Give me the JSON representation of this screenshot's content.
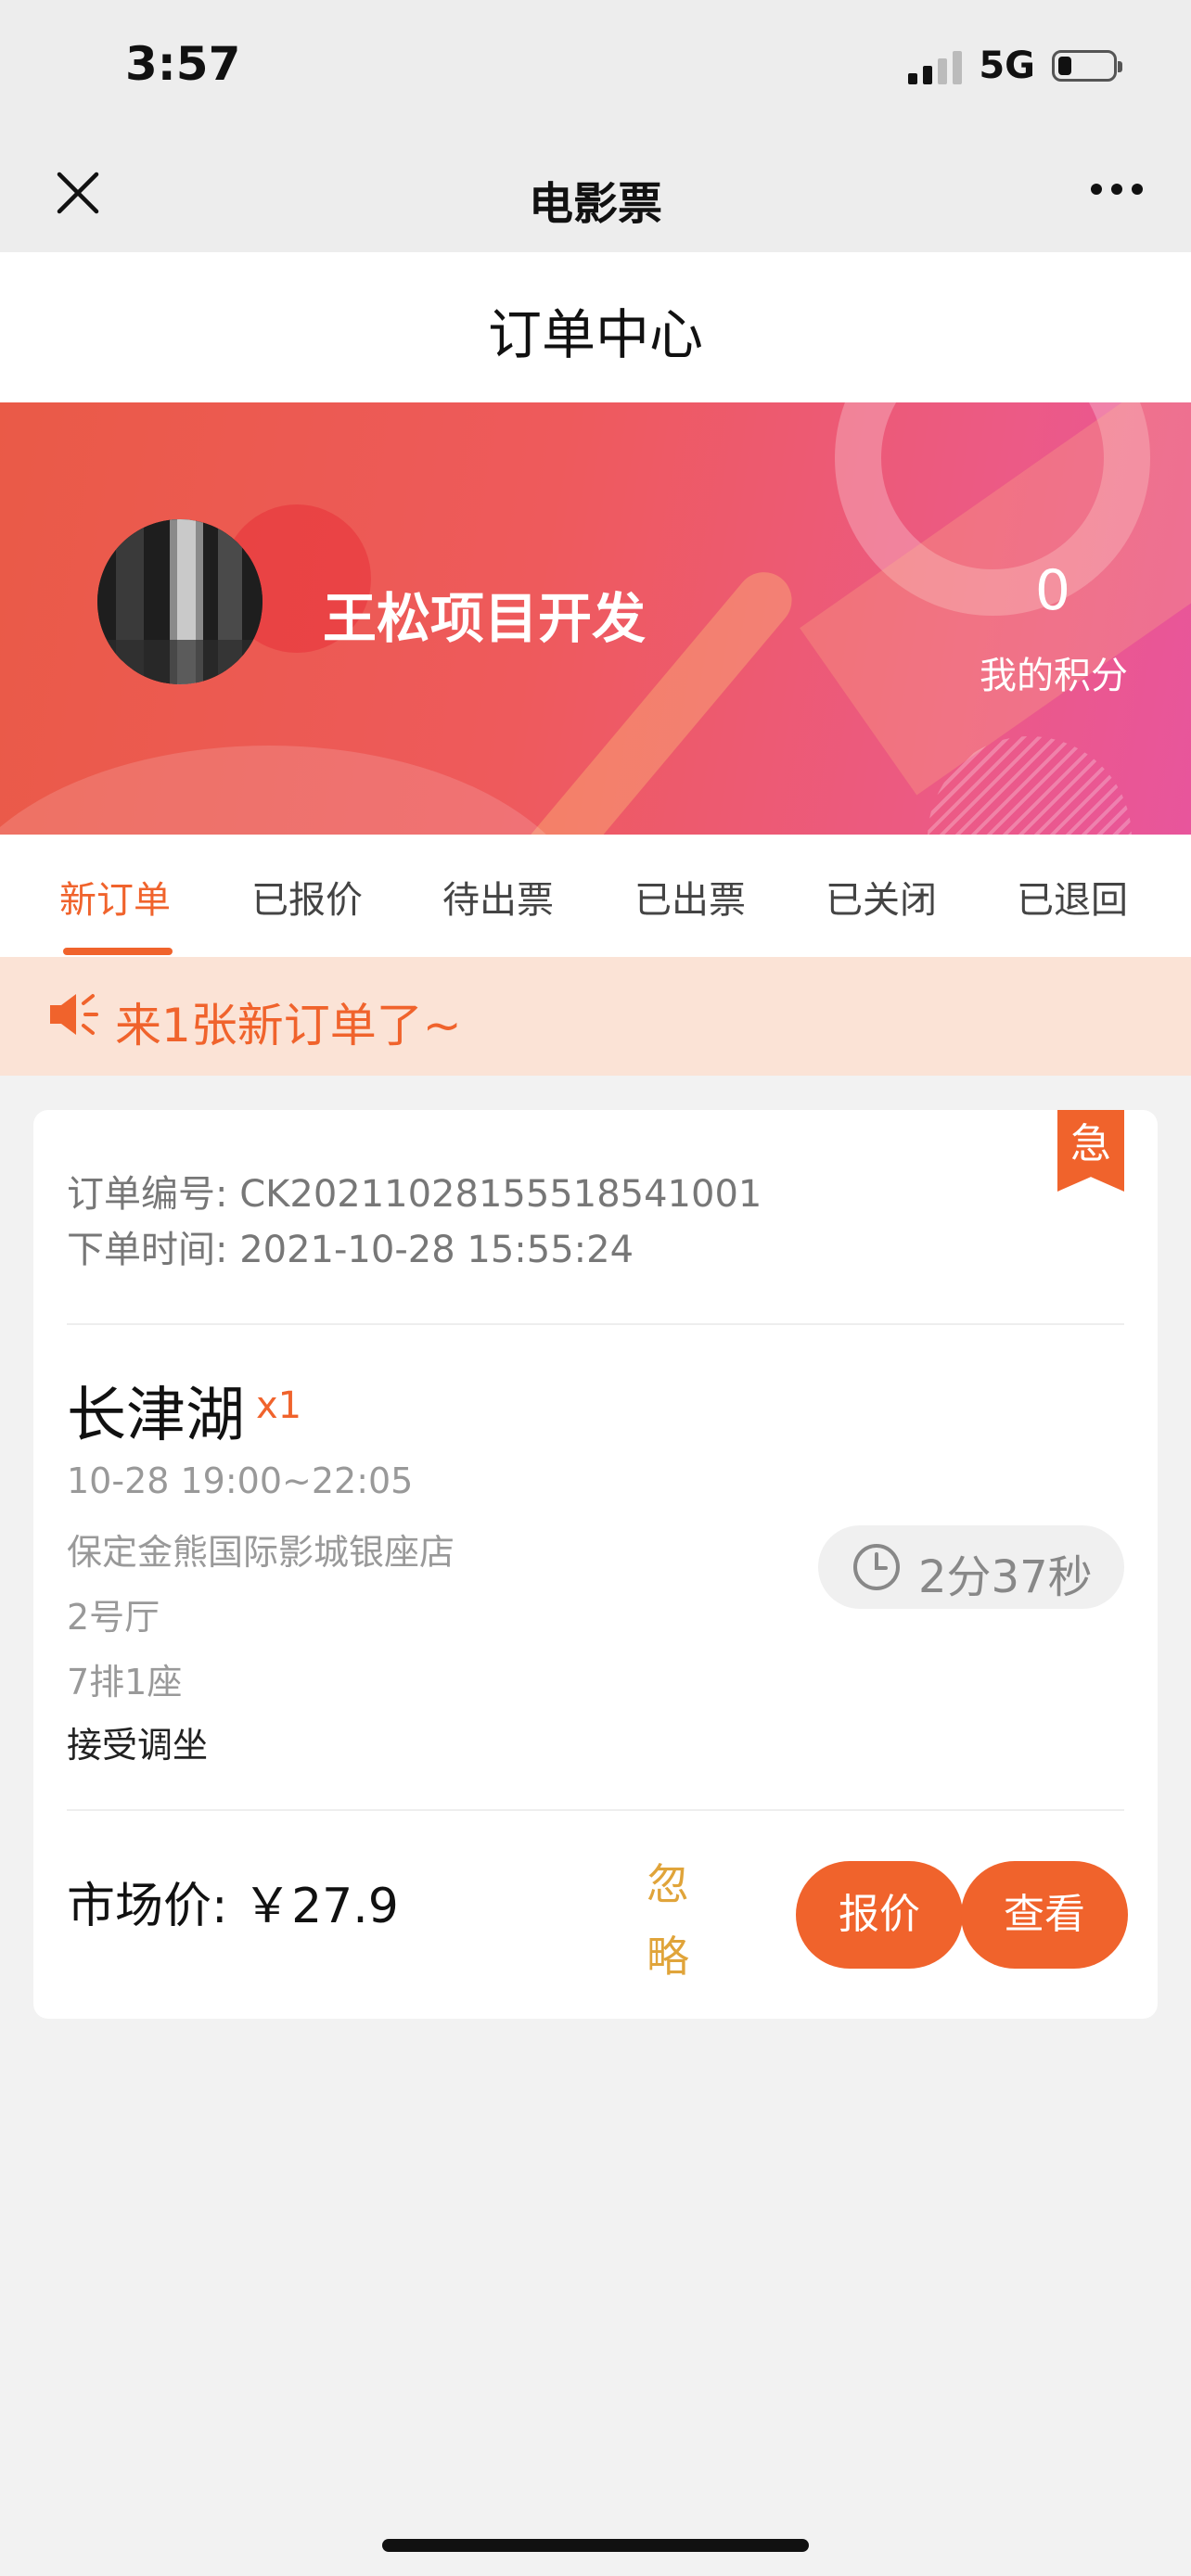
{
  "status_bar": {
    "time": "3:57",
    "network": "5G"
  },
  "nav": {
    "title": "电影票"
  },
  "page": {
    "title": "订单中心"
  },
  "profile": {
    "name": "王松项目开发",
    "points_value": "0",
    "points_label": "我的积分"
  },
  "tabs": [
    {
      "label": "新订单",
      "active": true
    },
    {
      "label": "已报价"
    },
    {
      "label": "待出票"
    },
    {
      "label": "已出票"
    },
    {
      "label": "已关闭"
    },
    {
      "label": "已退回"
    }
  ],
  "notice": {
    "text": "来1张新订单了~"
  },
  "order": {
    "badge": "急",
    "order_no_label": "订单编号:",
    "order_no": "CK20211028155518541001",
    "order_time_label": "下单时间:",
    "order_time": "2021-10-28 15:55:24",
    "movie": "长津湖",
    "quantity": "x1",
    "showtime": "10-28 19:00~22:05",
    "cinema": "保定金熊国际影城银座店",
    "hall": "2号厅",
    "seat": "7排1座",
    "seat_adjust": "接受调坐",
    "countdown": "2分37秒",
    "price_label": "市场价:",
    "price": "￥27.9",
    "ignore_label": "忽略",
    "quote_label": "报价",
    "view_label": "查看"
  },
  "colors": {
    "accent": "#f0632c",
    "ignore": "#e0a43a",
    "notice_bg": "#fbe3d6"
  }
}
